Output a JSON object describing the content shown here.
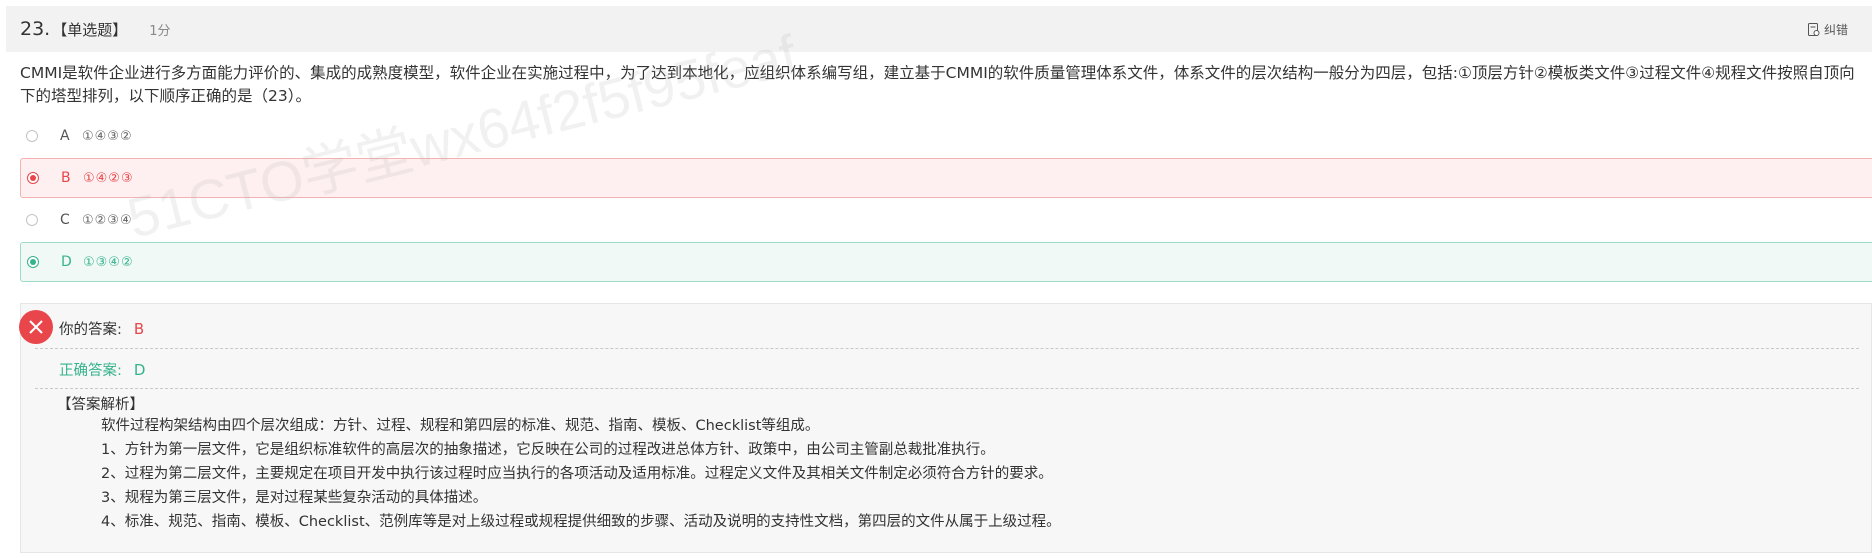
{
  "header": {
    "number": "23.",
    "type": "【单选题】",
    "score": "1分",
    "report_label": "纠错"
  },
  "question": {
    "text": "CMMI是软件企业进行多方面能力评价的、集成的成熟度模型，软件企业在实施过程中，为了达到本地化，应组织体系编写组，建立基于CMMI的软件质量管理体系文件，体系文件的层次结构一般分为四层，包括:①顶层方针②模板类文件③过程文件④规程文件按照自顶向下的塔型排列，以下顺序正确的是（23）。"
  },
  "options": [
    {
      "letter": "A",
      "text": "①④③②",
      "state": "normal"
    },
    {
      "letter": "B",
      "text": "①④②③",
      "state": "wrong-selected"
    },
    {
      "letter": "C",
      "text": "①②③④",
      "state": "normal"
    },
    {
      "letter": "D",
      "text": "①③④②",
      "state": "correct"
    }
  ],
  "watermark": "51CTO学堂wx64f2f5f95feaf",
  "result": {
    "your_label": "你的答案:",
    "your_value": "B",
    "correct_label": "正确答案:",
    "correct_value": "D",
    "status_icon": "close-icon"
  },
  "explanation": {
    "title": "【答案解析】",
    "lines": [
      "软件过程构架结构由四个层次组成：方针、过程、规程和第四层的标准、规范、指南、模板、Checklist等组成。",
      "1、方针为第一层文件，它是组织标准软件的高层次的抽象描述，它反映在公司的过程改进总体方针、政策中，由公司主管副总裁批准执行。",
      "2、过程为第二层文件，主要规定在项目开发中执行该过程时应当执行的各项活动及适用标准。过程定义文件及其相关文件制定必须符合方针的要求。",
      "3、规程为第三层文件，是对过程某些复杂活动的具体描述。",
      "4、标准、规范、指南、模板、Checklist、范例库等是对上级过程或规程提供细致的步骤、活动及说明的支持性文档，第四层的文件从属于上级过程。"
    ]
  },
  "colors": {
    "wrong": "#e8464a",
    "correct": "#36b38c",
    "header_bg": "#f2f2f2"
  }
}
